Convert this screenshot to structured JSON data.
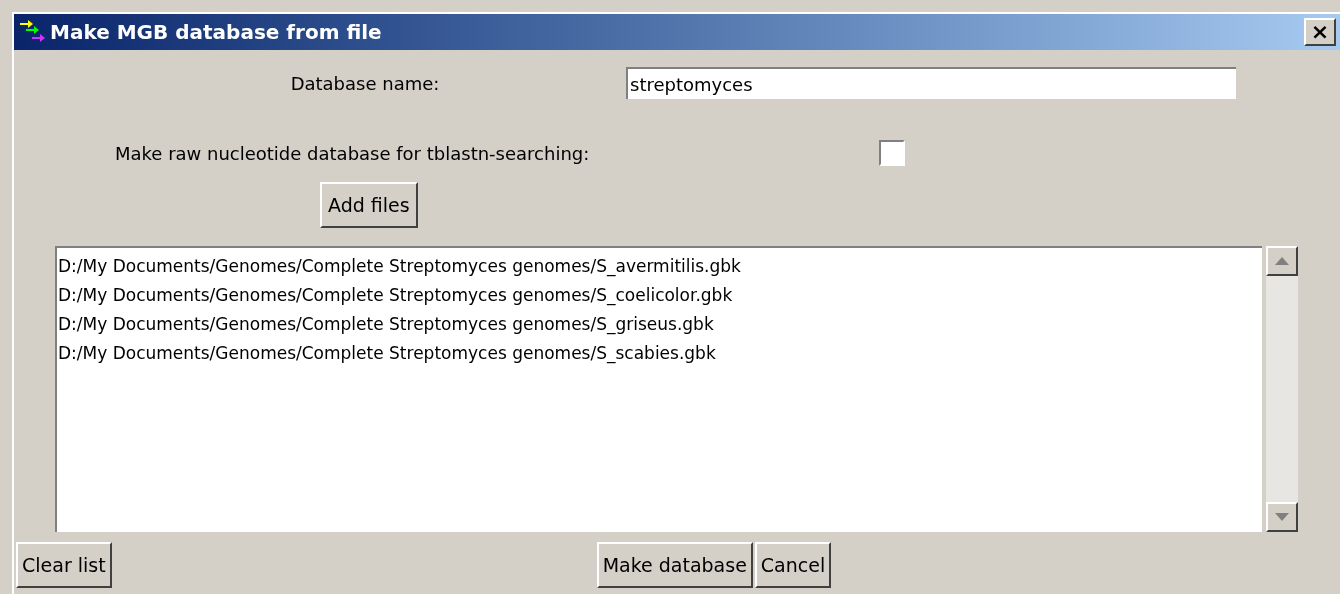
{
  "window": {
    "title": "Make MGB database from file",
    "close": "×"
  },
  "database_name": {
    "label": "Database name:",
    "value": "streptomyces"
  },
  "raw_nucleotide": {
    "label": "Make raw nucleotide database for tblastn-searching:",
    "checked": false
  },
  "add_files_button": "Add files",
  "files": [
    "D:/My Documents/Genomes/Complete Streptomyces genomes/S_avermitilis.gbk",
    "D:/My Documents/Genomes/Complete Streptomyces genomes/S_coelicolor.gbk",
    "D:/My Documents/Genomes/Complete Streptomyces genomes/S_griseus.gbk",
    "D:/My Documents/Genomes/Complete Streptomyces genomes/S_scabies.gbk"
  ],
  "buttons": {
    "clear": "Clear list",
    "make": "Make database",
    "cancel": "Cancel"
  }
}
